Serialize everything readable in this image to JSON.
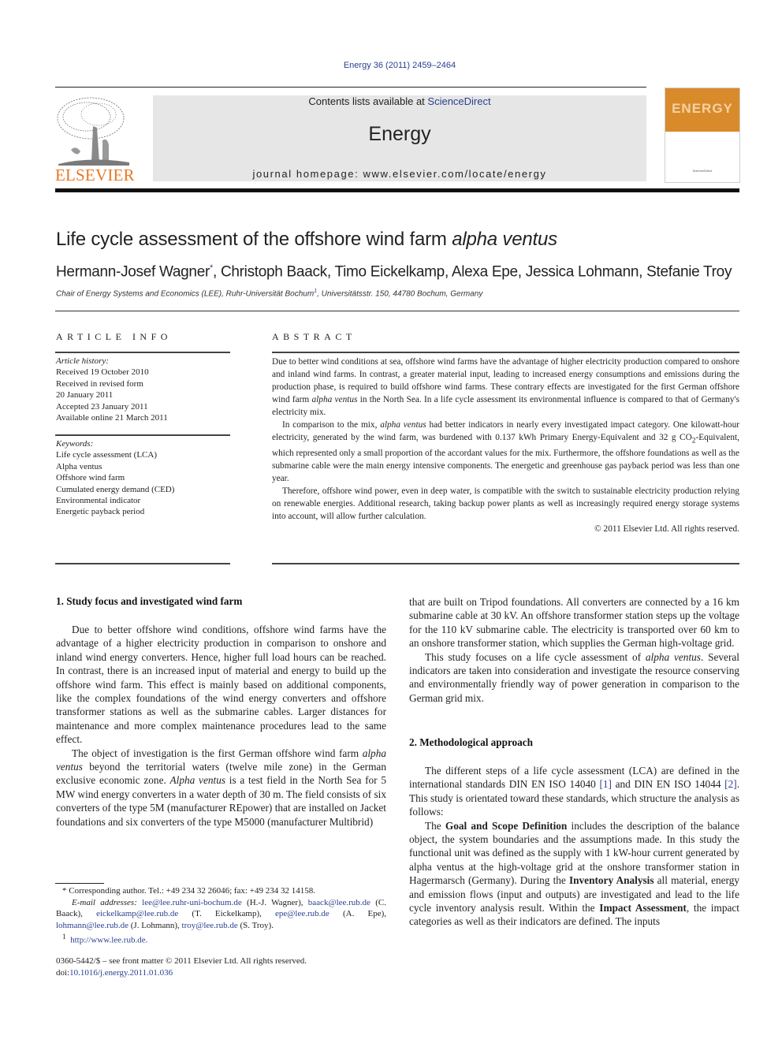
{
  "header": {
    "citation": "Energy 36 (2011) 2459–2464",
    "contents_prefix": "Contents lists available at ",
    "contents_link": "ScienceDirect",
    "journal_name": "Energy",
    "homepage": "journal homepage: www.elsevier.com/locate/energy",
    "publisher_logo_text": "ELSEVIER",
    "cover_title": "ENERGY",
    "cover_footer": "ScienceDirect",
    "colors": {
      "link": "#2a3f8f",
      "publisher_orange": "#e87722",
      "cover_orange": "#d98a2b",
      "band_gray": "#e6e6e6"
    }
  },
  "article": {
    "title_main": "Life cycle assessment of the offshore wind farm ",
    "title_italic": "alpha ventus",
    "authors": [
      {
        "name": "Hermann-Josef Wagner",
        "mark": "*"
      },
      {
        "name": "Christoph Baack"
      },
      {
        "name": "Timo Eickelkamp"
      },
      {
        "name": "Alexa Epe"
      },
      {
        "name": "Jessica Lohmann"
      },
      {
        "name": "Stefanie Troy"
      }
    ],
    "affiliation_a": "Chair of Energy Systems and Economics (LEE), Ruhr-Universität Bochum",
    "affiliation_mark": "1",
    "affiliation_b": ", Universitätsstr. 150, 44780 Bochum, Germany"
  },
  "article_info": {
    "heading": "ARTICLE INFO",
    "history_label": "Article history:",
    "history": [
      "Received 19 October 2010",
      "Received in revised form",
      "20 January 2011",
      "Accepted 23 January 2011",
      "Available online 21 March 2011"
    ],
    "keywords_label": "Keywords:",
    "keywords": [
      "Life cycle assessment (LCA)",
      "Alpha ventus",
      "Offshore wind farm",
      "Cumulated energy demand (CED)",
      "Environmental indicator",
      "Energetic payback period"
    ]
  },
  "abstract": {
    "heading": "ABSTRACT",
    "p1a": "Due to better wind conditions at sea, offshore wind farms have the advantage of higher electricity production compared to onshore and inland wind farms. In contrast, a greater material input, leading to increased energy consumptions and emissions during the production phase, is required to build offshore wind farms. These contrary effects are investigated for the first German offshore wind farm ",
    "p1_italic": "alpha ventus",
    "p1b": " in the North Sea. In a life cycle assessment its environmental influence is compared to that of Germany's electricity mix.",
    "p2a": "In comparison to the mix, ",
    "p2_italic": "alpha ventus",
    "p2b": " had better indicators in nearly every investigated impact category. One kilowatt-hour electricity, generated by the wind farm, was burdened with 0.137 kWh Primary Energy-Equivalent and 32 g CO",
    "p2_sub": "2",
    "p2c": "-Equivalent, which represented only a small proportion of the accordant values for the mix. Furthermore, the offshore foundations as well as the submarine cable were the main energy intensive components. The energetic and greenhouse gas payback period was less than one year.",
    "p3": "Therefore, offshore wind power, even in deep water, is compatible with the switch to sustainable electricity production relying on renewable energies. Additional research, taking backup power plants as well as increasingly required energy storage systems into account, will allow further calculation.",
    "copyright": "© 2011 Elsevier Ltd. All rights reserved."
  },
  "body": {
    "section1": {
      "heading": "1.  Study focus and investigated wind farm",
      "p1": "Due to better offshore wind conditions, offshore wind farms have the advantage of a higher electricity production in comparison to onshore and inland wind energy converters. Hence, higher full load hours can be reached. In contrast, there is an increased input of material and energy to build up the offshore wind farm. This effect is mainly based on additional components, like the complex foundations of the wind energy converters and offshore transformer stations as well as the submarine cables. Larger distances for maintenance and more complex maintenance procedures lead to the same effect.",
      "p2a": "The object of investigation is the first German offshore wind farm ",
      "p2_italic1": "alpha ventus",
      "p2b": " beyond the territorial waters (twelve mile zone) in the German exclusive economic zone. ",
      "p2_italic2": "Alpha ventus",
      "p2c": " is a test field in the North Sea for 5 MW wind energy converters in a water depth of 30 m. The field consists of six converters of the type 5M (manufacturer REpower) that are installed on Jacket foundations and six converters of the type M5000 (manufacturer Multibrid)",
      "p3": "that are built on Tripod foundations. All converters are connected by a 16 km submarine cable at 30 kV. An offshore transformer station steps up the voltage for the 110 kV submarine cable. The electricity is transported over 60 km to an onshore transformer station, which supplies the German high-voltage grid.",
      "p4a": "This study focuses on a life cycle assessment of ",
      "p4_italic": "alpha ventus",
      "p4b": ". Several indicators are taken into consideration and investigate the resource conserving and environmentally friendly way of power generation in comparison to the German grid mix."
    },
    "section2": {
      "heading": "2.  Methodological approach",
      "p1a": "The different steps of a life cycle assessment (LCA) are defined in the international standards DIN EN ISO 14040 ",
      "ref1": "[1]",
      "p1b": " and DIN EN ISO 14044 ",
      "ref2": "[2]",
      "p1c": ". This study is orientated toward these standards, which structure the analysis as follows:",
      "p2a": "The ",
      "p2_bold1": "Goal and Scope Definition",
      "p2b": " includes the description of the balance object, the system boundaries and the assumptions made. In this study the functional unit was defined as the supply with 1 kW-hour current generated by alpha ventus at the high-voltage grid at the onshore transformer station in Hagermarsch (Germany). During the ",
      "p2_bold2": "Inventory Analysis",
      "p2c": " all material, energy and emission flows (input and outputs) are investigated and lead to the life cycle inventory analysis result. Within the ",
      "p2_bold3": "Impact Assessment",
      "p2d": ", the impact categories as well as their indicators are defined. The inputs"
    }
  },
  "footnotes": {
    "corresponding": "* Corresponding author. Tel.: +49 234 32 26046; fax: +49 234 32 14158.",
    "email_label": "E-mail addresses: ",
    "emails": [
      {
        "address": "lee@lee.ruhr-uni-bochum.de",
        "who": " (H.-J. Wagner), "
      },
      {
        "address": "baack@lee.rub.de",
        "who": " (C. Baack), "
      },
      {
        "address": "eickelkamp@lee.rub.de",
        "who": " (T. Eickelkamp), "
      },
      {
        "address": "epe@lee.rub.de",
        "who": " (A. Epe), "
      },
      {
        "address": "lohmann@lee.rub.de",
        "who": " (J. Lohmann), "
      },
      {
        "address": "troy@lee.rub.de",
        "who": " (S. Troy)."
      }
    ],
    "fn1_mark": "1",
    "fn1_url": "http://www.lee.rub.de."
  },
  "front_matter": {
    "issn_line": "0360-5442/$ – see front matter © 2011 Elsevier Ltd. All rights reserved.",
    "doi_prefix": "doi:",
    "doi": "10.1016/j.energy.2011.01.036"
  }
}
